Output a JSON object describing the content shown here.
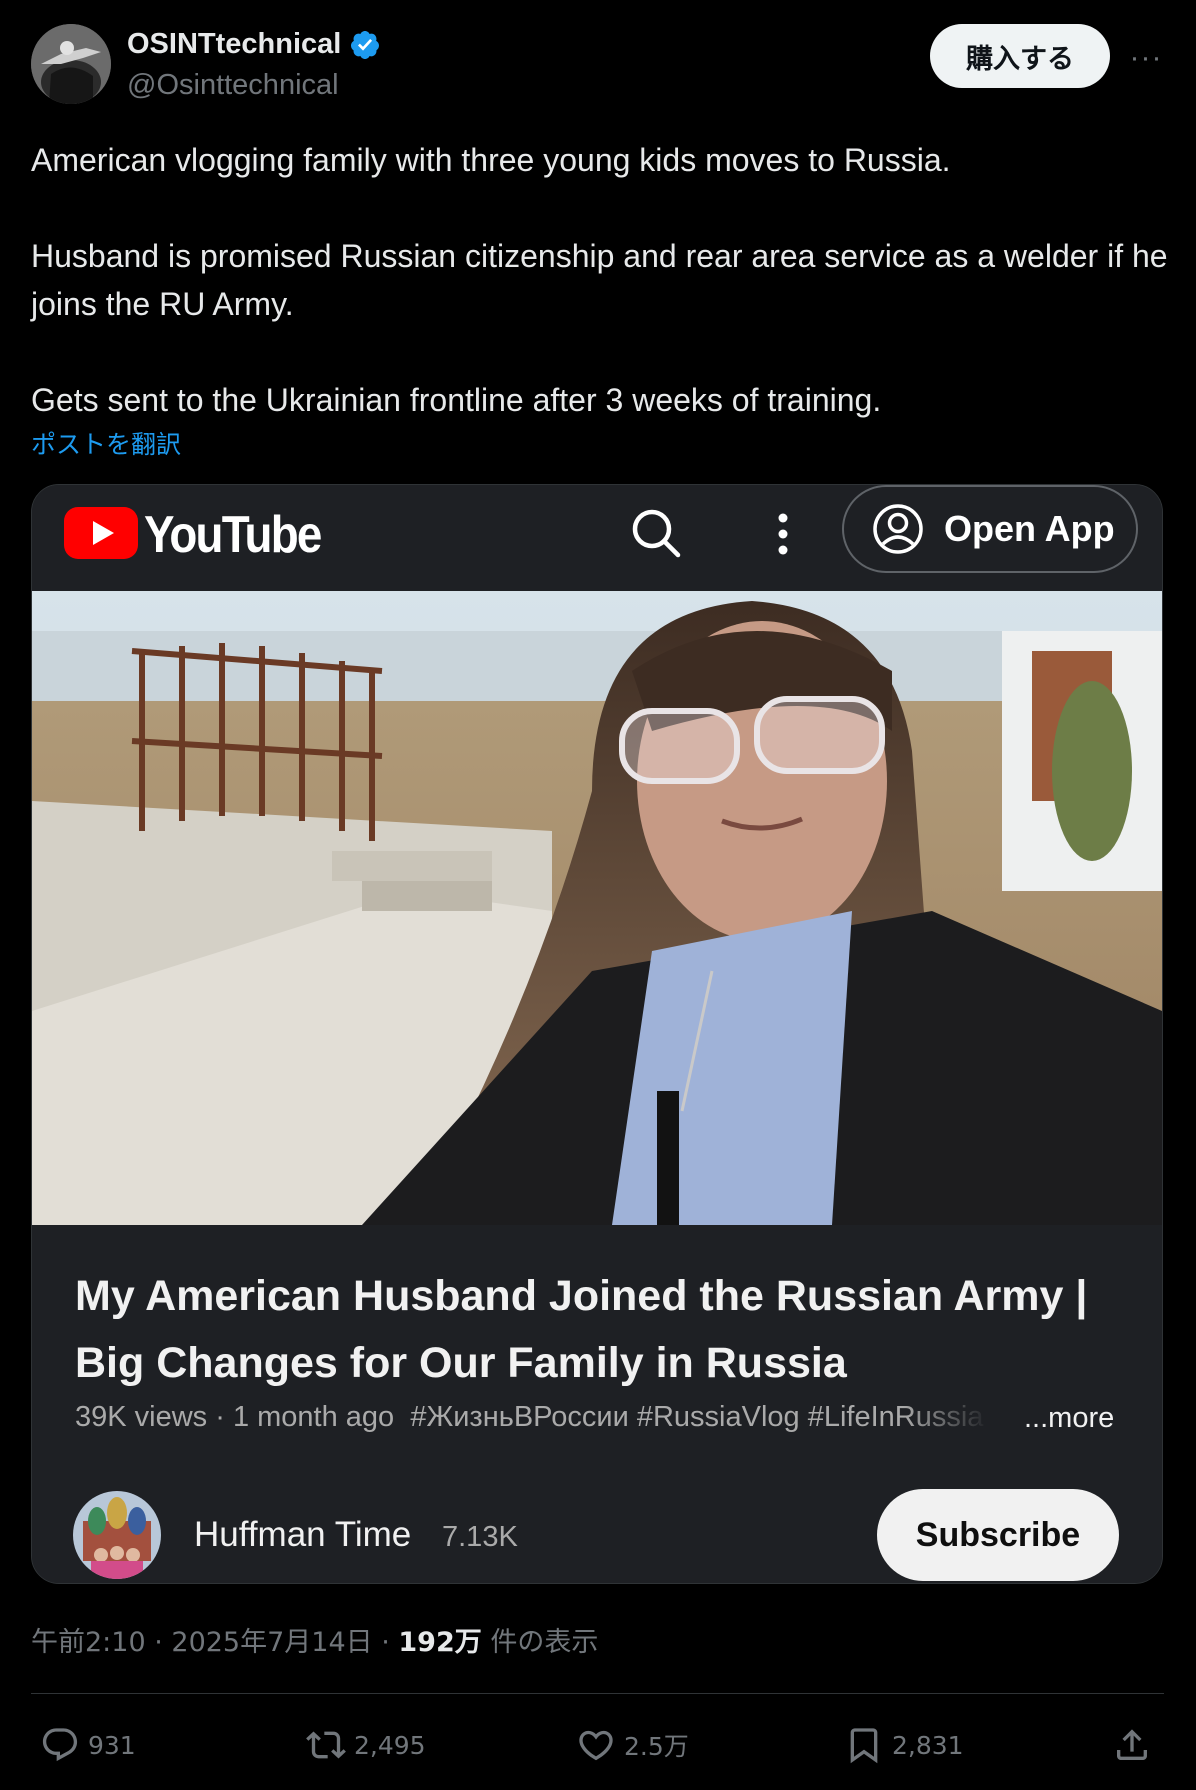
{
  "author": {
    "display_name": "OSINTtechnical",
    "handle": "@Osinttechnical",
    "verified": true
  },
  "header": {
    "buy_label": "購入する",
    "more_label": "···"
  },
  "post": {
    "paragraphs": [
      "American vlogging family with three young kids moves to Russia.",
      "Husband is promised Russian citizenship and rear area service as a welder if he joins the RU Army.",
      "Gets sent to the Ukrainian frontline after 3 weeks of training."
    ],
    "translate_label": "ポストを翻訳"
  },
  "card": {
    "brand": "YouTube",
    "open_app_label": "Open App",
    "video": {
      "title": "My American Husband Joined the Russian Army | Big Changes for Our Family in Russia",
      "views": "39K views",
      "age": "1 month ago",
      "hashtags": "#ЖизньВРоссии #RussiaVlog #LifeInRussia",
      "more_label": "...more"
    },
    "channel": {
      "name": "Huffman Time",
      "subscribers": "7.13K",
      "subscribe_label": "Subscribe"
    }
  },
  "meta": {
    "time": "午前2:10",
    "separator": " · ",
    "date": "2025年7月14日",
    "views_count": "192万",
    "views_suffix": " 件の表示"
  },
  "actions": {
    "replies": "931",
    "reposts": "2,495",
    "likes": "2.5万",
    "bookmarks": "2,831"
  },
  "colors": {
    "background": "#000000",
    "text": "#e7e9ea",
    "muted": "#71767b",
    "link": "#1d9bf0",
    "verified": "#1d9bf0",
    "youtube_red": "#ff0000"
  }
}
